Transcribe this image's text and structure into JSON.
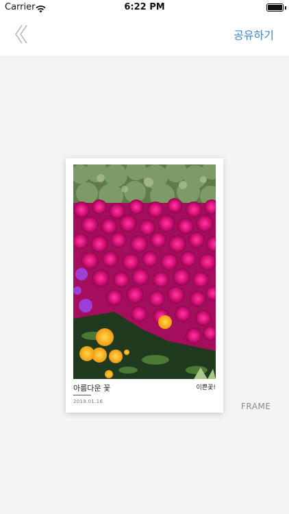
{
  "status_bar": {
    "carrier": "Carrier",
    "time": "6:22 PM",
    "battery_level": 1.0
  },
  "nav": {
    "back_icon": "double-chevron-left-icon",
    "share_label": "공유하기",
    "accent_color": "#3f86c9"
  },
  "card": {
    "photo_subject": "flowers-photo",
    "title": "아름다운 꽃",
    "tag": "이쁜꽃!",
    "date": "2019.01.16"
  },
  "frame_label": "FRAME"
}
